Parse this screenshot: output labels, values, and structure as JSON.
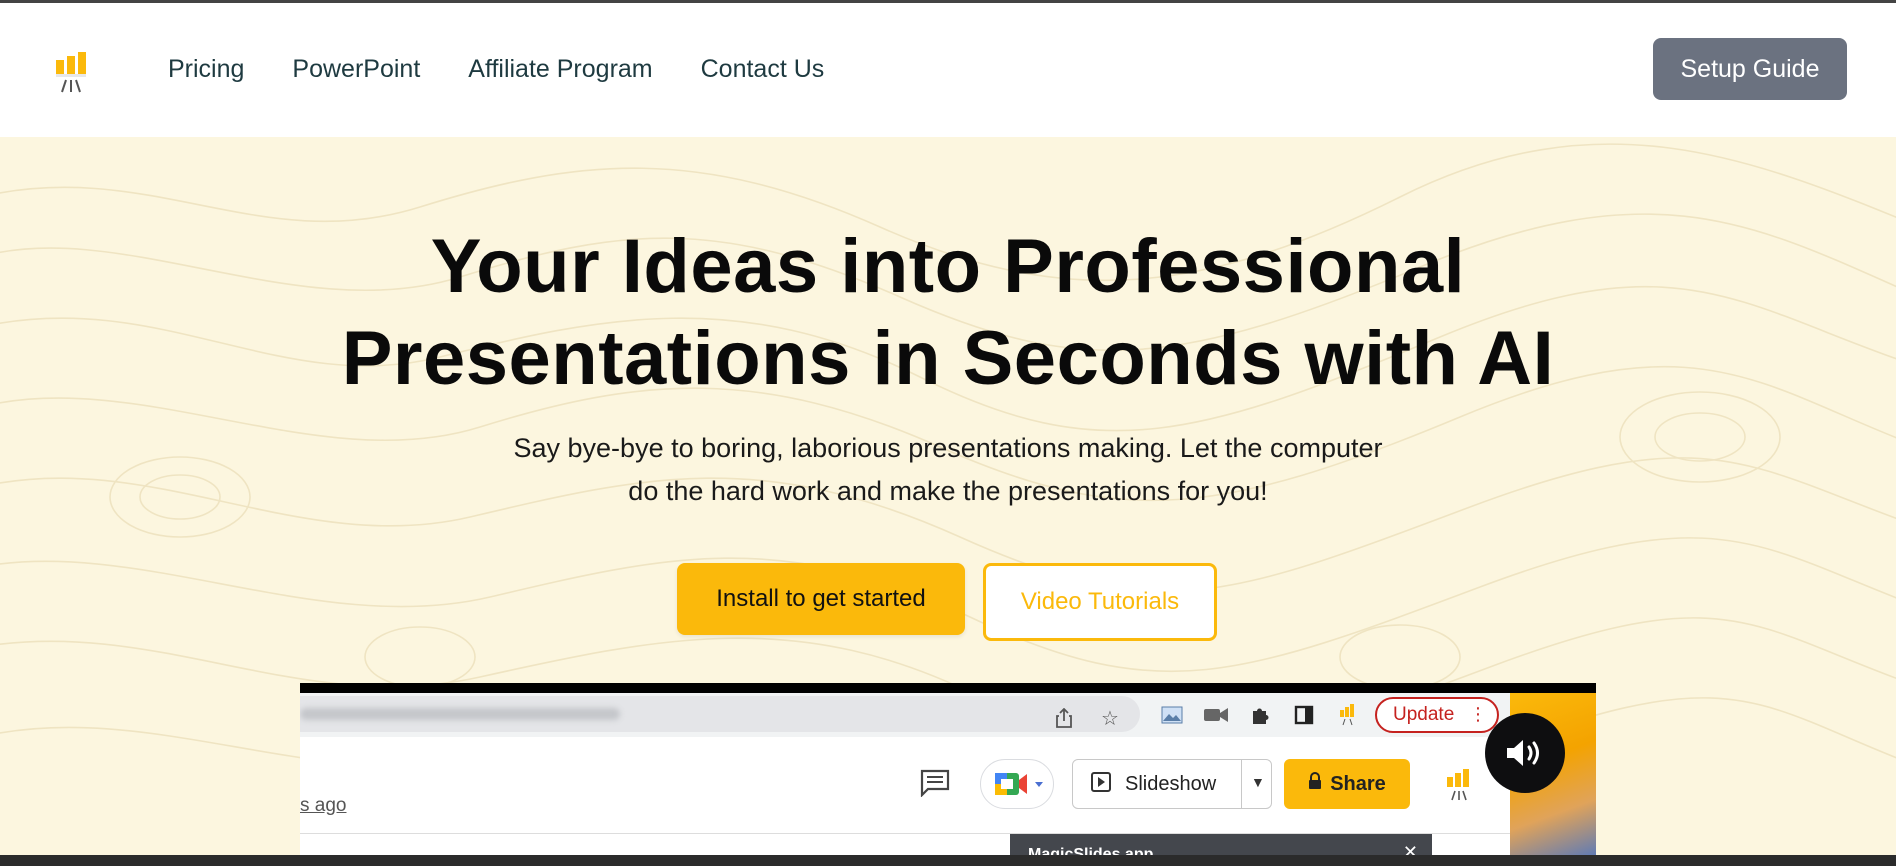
{
  "header": {
    "logo_icon": "magicslides-logo-icon",
    "nav": [
      {
        "label": "Pricing"
      },
      {
        "label": "PowerPoint"
      },
      {
        "label": "Affiliate Program"
      },
      {
        "label": "Contact Us"
      }
    ],
    "setup_button": "Setup Guide"
  },
  "hero": {
    "headline_line1": "Your Ideas into Professional",
    "headline_line2": "Presentations in Seconds with AI",
    "subtitle_line1": "Say bye-bye to boring, laborious presentations making. Let the computer",
    "subtitle_line2": "do the hard work and make the presentations for you!",
    "install_button": "Install to get started",
    "tutorials_button": "Video Tutorials"
  },
  "video": {
    "update_button": "Update",
    "time_ago": "s ago",
    "slideshow_label": "Slideshow",
    "share_label": "Share",
    "panel_title": "MagicSlides app",
    "sound_icon": "volume-icon"
  },
  "colors": {
    "accent": "#fbb90b",
    "hero_bg": "#fcf6df",
    "setup_button_bg": "#6b7280",
    "nav_text": "#1e3a40"
  }
}
